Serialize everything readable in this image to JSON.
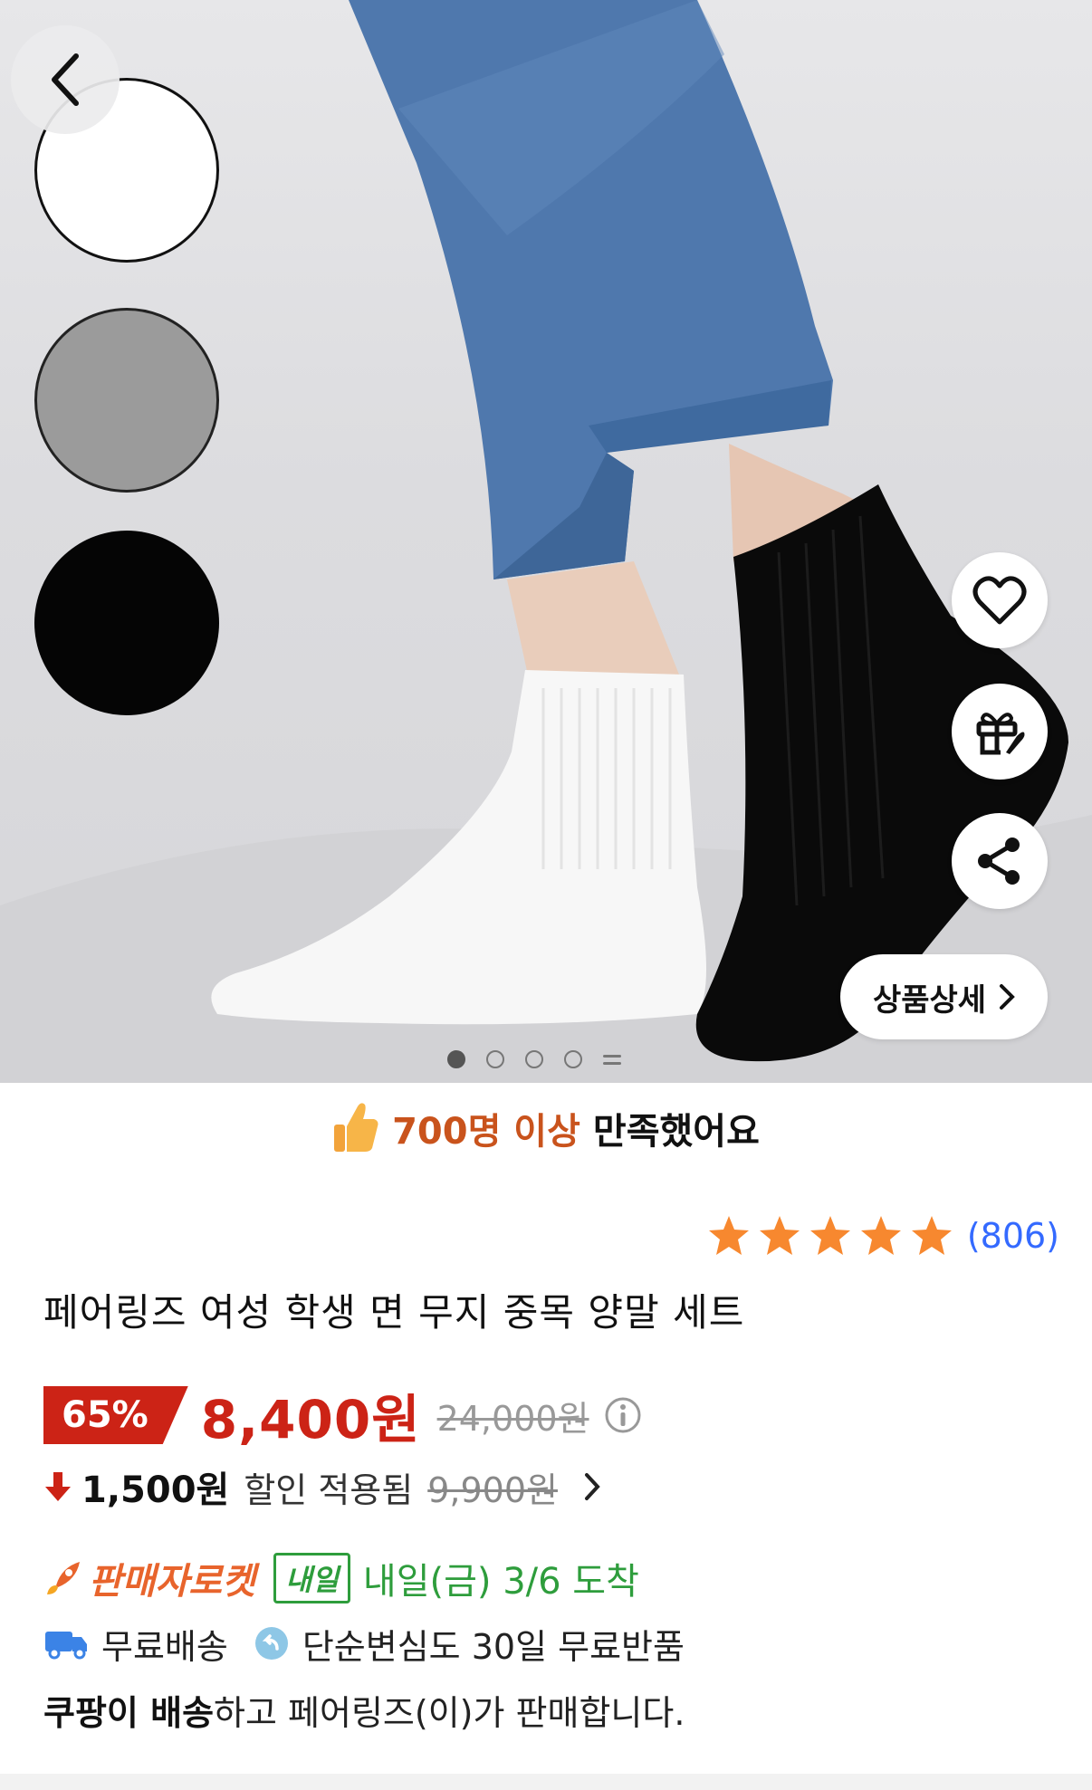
{
  "colors": {
    "accent_red": "#cc2316",
    "rocket_orange": "#e8642c",
    "delivery_green": "#2e9d3c",
    "link_blue": "#346aff",
    "star_orange": "#f7882f"
  },
  "hero": {
    "back_icon": "chevron-left-icon",
    "color_swatches": [
      "white",
      "gray",
      "black"
    ],
    "actions": [
      "heart-icon",
      "gift-rocket-icon",
      "share-icon"
    ],
    "detail_button": "상품상세",
    "pagination": {
      "total_visible": 4,
      "active": 1,
      "has_more": true
    }
  },
  "satisfaction": {
    "highlight": "700명 이상",
    "text": "만족했어요"
  },
  "rating": {
    "stars": 5,
    "count": "(806)"
  },
  "product": {
    "title": "페어링즈 여성 학생 면 무지 중목 양말 세트"
  },
  "price": {
    "discount": "65%",
    "sale_price": "8,400원",
    "original_price": "24,000원"
  },
  "coupon": {
    "amount": "1,500원",
    "label": "할인 적용됨",
    "original": "9,900원"
  },
  "delivery": {
    "rocket_label": "판매자로켓",
    "badge": "내일",
    "arrival": "내일(금) 3/6 도착",
    "free_shipping": "무료배송",
    "return_policy": "단순변심도 30일 무료반품"
  },
  "seller": {
    "bold": "쿠팡이 배송",
    "rest": "하고 페어링즈(이)가 판매합니다."
  }
}
